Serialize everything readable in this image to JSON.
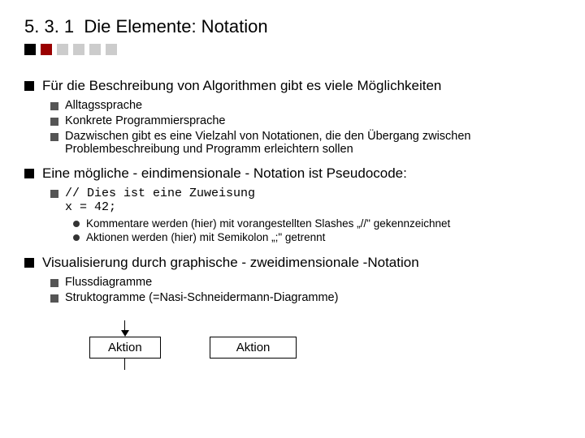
{
  "heading": {
    "number": "5. 3. 1",
    "title": "Die Elemente: Notation"
  },
  "decor": {
    "colors": [
      "#000000",
      "#9a0000",
      "#cccccc",
      "#cccccc",
      "#cccccc",
      "#cccccc"
    ]
  },
  "bullets": [
    {
      "text": "Für die Beschreibung von Algorithmen gibt es viele Möglichkeiten",
      "children": [
        {
          "text": "Alltagssprache"
        },
        {
          "text": "Konkrete Programmiersprache"
        },
        {
          "text": "Dazwischen gibt es eine Vielzahl von Notationen, die den Übergang zwischen Problembeschreibung und Programm erleichtern sollen"
        }
      ]
    },
    {
      "text": "Eine mögliche - eindimensionale - Notation ist Pseudocode:",
      "children": [
        {
          "code": true,
          "line1": "// Dies ist eine Zuweisung",
          "line2": "x = 42;",
          "children": [
            {
              "text": "Kommentare werden (hier) mit vorangestellten Slashes „//\" gekennzeichnet"
            },
            {
              "text": "Aktionen werden (hier) mit Semikolon „;\" getrennt"
            }
          ]
        }
      ]
    },
    {
      "text": "Visualisierung durch graphische - zweidimensionale -Notation",
      "children": [
        {
          "text": "Flussdiagramme"
        },
        {
          "text": "Struktogramme (=Nasi-Schneidermann-Diagramme)"
        }
      ]
    }
  ],
  "diagrams": {
    "flowchart_label": "Aktion",
    "structogram_label": "Aktion"
  }
}
